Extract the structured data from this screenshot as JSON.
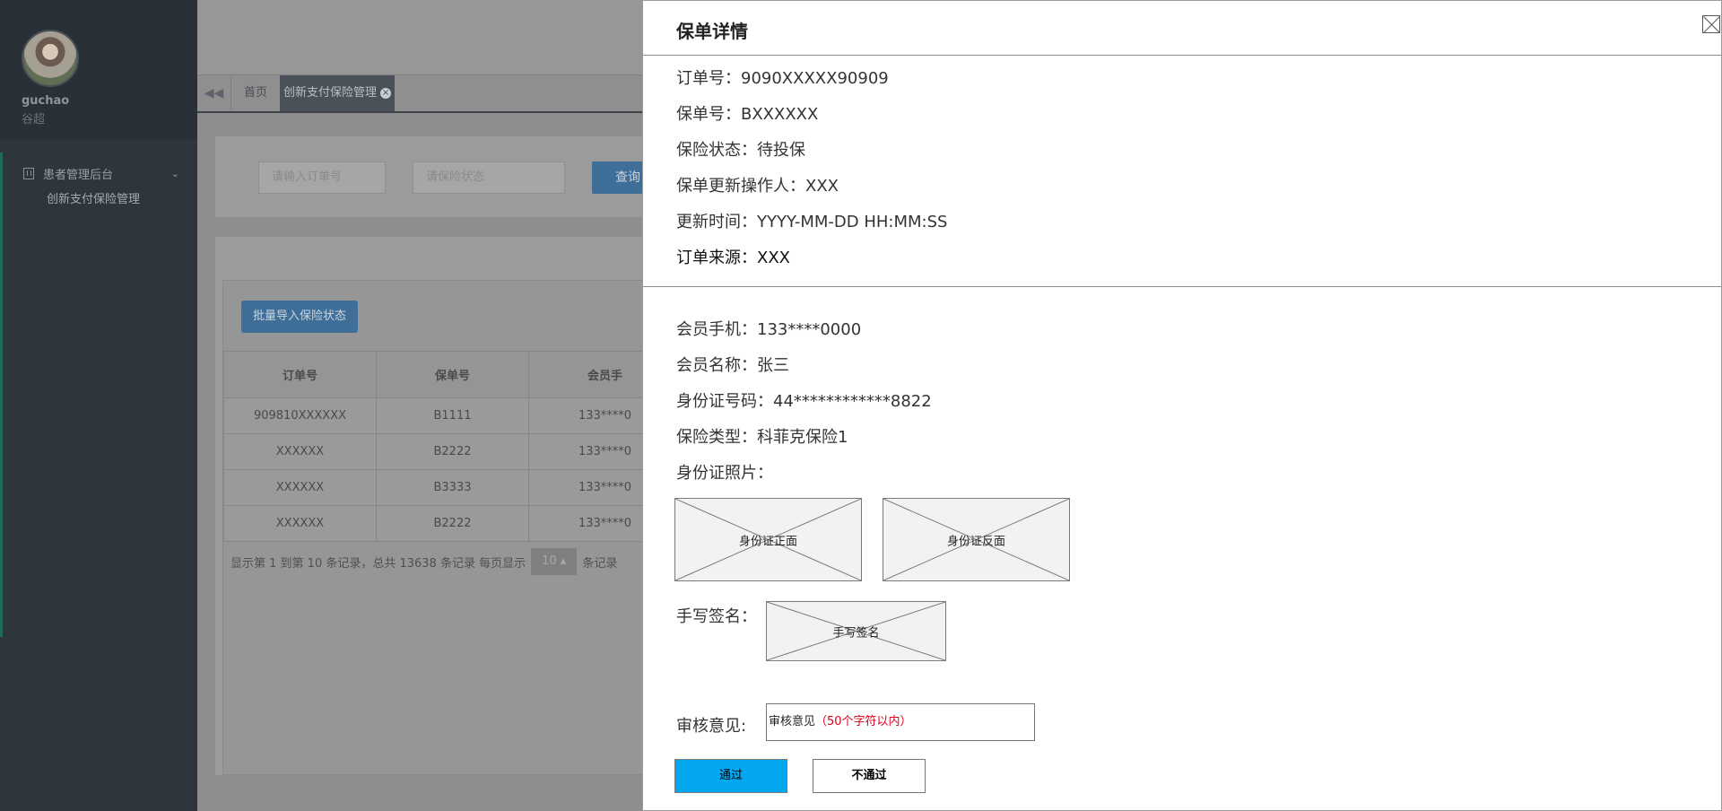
{
  "sidebar": {
    "user": {
      "name": "guchao",
      "subname": "谷超"
    },
    "menu": {
      "group_label": "患者管理后台",
      "items": [
        {
          "label": "创新支付保险管理"
        }
      ]
    }
  },
  "tabs": {
    "items": [
      {
        "label": "首页"
      },
      {
        "label": "创新支付保险管理"
      }
    ]
  },
  "filters": {
    "order_placeholder": "请输入订单号",
    "status_placeholder": "请保险状态",
    "search_label": "查询"
  },
  "list": {
    "import_label": "批量导入保险状态",
    "columns": [
      "订单号",
      "保单号",
      "会员手"
    ],
    "rows": [
      [
        "909810XXXXXX",
        "B1111",
        "133****0"
      ],
      [
        "XXXXXX",
        "B2222",
        "133****0"
      ],
      [
        "XXXXXX",
        "B3333",
        "133****0"
      ],
      [
        "XXXXXX",
        "B2222",
        "133****0"
      ]
    ],
    "pager": {
      "summary": "显示第 1 到第 10 条记录，总共 13638 条记录 每页显示",
      "page_size": "10",
      "suffix": "条记录"
    }
  },
  "modal": {
    "title": "保单详情",
    "fields": {
      "order_no": "订单号：9090XXXXX90909",
      "policy_no": "保单号：BXXXXXX",
      "status": "保险状态：待投保",
      "operator": "保单更新操作人：XXX",
      "updated_at": "更新时间：YYYY-MM-DD HH:MM:SS",
      "source": "订单来源：XXX",
      "phone": "会员手机：133****0000",
      "member_name": "会员名称：张三",
      "id_number": "身份证号码：44************8822",
      "insurance_type": "保险类型：科菲克保险1",
      "id_photo_label": "身份证照片："
    },
    "id_front_caption": "身份证正面",
    "id_back_caption": "身份证反面",
    "signature_label": "手写签名：",
    "signature_caption": "手写签名",
    "review_label": "审核意见:",
    "review_input_prefix": "审核意见",
    "review_input_hint": "（50个字符以内）",
    "approve_label": "通过",
    "reject_label": "不通过"
  },
  "colors": {
    "sidebar_bg": "#2f353d",
    "primary_button": "#02a7f0",
    "hint_red": "#d9001b"
  }
}
